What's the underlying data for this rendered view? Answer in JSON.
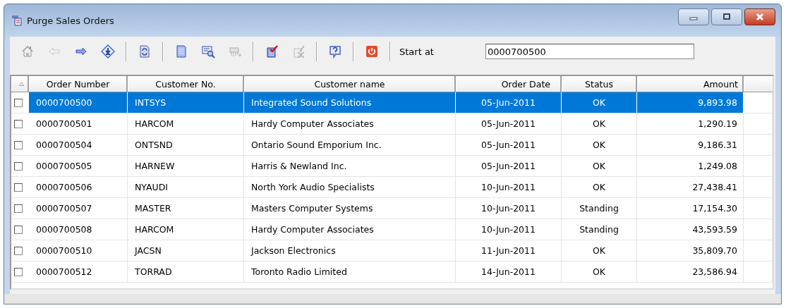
{
  "window": {
    "title": "Purge Sales Orders"
  },
  "toolbar": [
    {
      "kind": "button",
      "disabled": false
    },
    {
      "kind": "button",
      "disabled": true
    },
    {
      "kind": "button",
      "disabled": false
    },
    {
      "kind": "button",
      "disabled": false
    },
    {
      "kind": "separator"
    },
    {
      "kind": "button",
      "disabled": false
    },
    {
      "kind": "separator"
    },
    {
      "kind": "button",
      "disabled": false
    },
    {
      "kind": "button",
      "disabled": false
    },
    {
      "kind": "button",
      "disabled": true
    },
    {
      "kind": "separator"
    },
    {
      "kind": "button",
      "disabled": false
    },
    {
      "kind": "button",
      "disabled": true
    },
    {
      "kind": "separator"
    },
    {
      "kind": "button",
      "disabled": false
    },
    {
      "kind": "separator"
    },
    {
      "kind": "button",
      "disabled": false
    },
    {
      "kind": "separator"
    }
  ],
  "start_at": {
    "label": "Start at",
    "value": "0000700500"
  },
  "table": {
    "columns": [
      "Order Number",
      "Customer No.",
      "Customer name",
      "Order Date",
      "Status",
      "Amount"
    ],
    "rows": [
      {
        "checked": false,
        "selected": true,
        "cells": [
          "0000700500",
          "INTSYS",
          "Integrated Sound Solutions",
          "05-Jun-2011",
          "OK",
          "9,893.98"
        ]
      },
      {
        "checked": false,
        "selected": false,
        "cells": [
          "0000700501",
          "HARCOM",
          "Hardy Computer Associates",
          "05-Jun-2011",
          "OK",
          "1,290.19"
        ]
      },
      {
        "checked": false,
        "selected": false,
        "cells": [
          "0000700504",
          "ONTSND",
          "Ontario Sound Emporium Inc.",
          "05-Jun-2011",
          "OK",
          "9,186.31"
        ]
      },
      {
        "checked": false,
        "selected": false,
        "cells": [
          "0000700505",
          "HARNEW",
          "Harris & Newland Inc.",
          "05-Jun-2011",
          "OK",
          "1,249.08"
        ]
      },
      {
        "checked": false,
        "selected": false,
        "cells": [
          "0000700506",
          "NYAUDI",
          "North York Audio Specialists",
          "10-Jun-2011",
          "OK",
          "27,438.41"
        ]
      },
      {
        "checked": false,
        "selected": false,
        "cells": [
          "0000700507",
          "MASTER",
          "Masters Computer Systems",
          "10-Jun-2011",
          "Standing",
          "17,154.30"
        ]
      },
      {
        "checked": false,
        "selected": false,
        "cells": [
          "0000700508",
          "HARCOM",
          "Hardy Computer Associates",
          "10-Jun-2011",
          "Standing",
          "43,593.59"
        ]
      },
      {
        "checked": false,
        "selected": false,
        "cells": [
          "0000700510",
          "JACSN",
          "Jackson Electronics",
          "11-Jun-2011",
          "OK",
          "35,809.70"
        ]
      },
      {
        "checked": false,
        "selected": false,
        "cells": [
          "0000700512",
          "TORRAD",
          "Toronto Radio Limited",
          "14-Jun-2011",
          "OK",
          "23,586.94"
        ]
      }
    ]
  }
}
